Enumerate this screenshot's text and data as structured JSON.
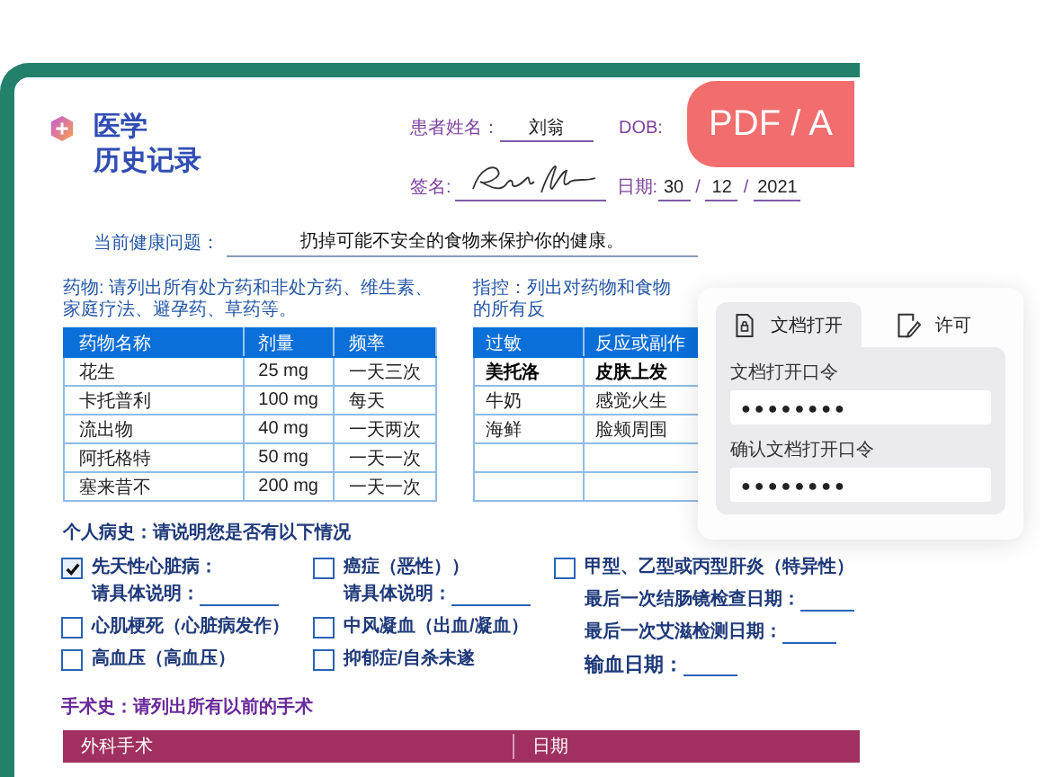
{
  "badge": "PDF / A",
  "document": {
    "title_lines": [
      "医学",
      "历史记录"
    ],
    "patient_name": {
      "label": "患者姓名：",
      "value": "刘翁"
    },
    "dob": {
      "label": "DOB:"
    },
    "signature": {
      "label": "签名:"
    },
    "date": {
      "label": "日期:",
      "separator": "/",
      "day": "30",
      "month": "12",
      "year": "2021"
    },
    "health_issue": {
      "label": "当前健康问题：",
      "value": "扔掉可能不安全的食物来保护你的健康。"
    },
    "medications": {
      "caption": "药物: 请列出所有处方药和非处方药、维生素、家庭疗法、避孕药、草药等。",
      "columns": [
        "药物名称",
        "剂量",
        "频率"
      ],
      "rows": [
        [
          "花生",
          "25 mg",
          "一天三次"
        ],
        [
          "卡托普利",
          "100 mg",
          "每天"
        ],
        [
          "流出物",
          "40 mg",
          "一天两次"
        ],
        [
          "阿托格特",
          "50 mg",
          "一天一次"
        ],
        [
          "塞来昔不",
          "200 mg",
          "一天一次"
        ]
      ]
    },
    "allergies": {
      "caption": "指控：列出对药物和食物的所有反",
      "columns": [
        "过敏",
        "反应或副作"
      ],
      "rows": [
        {
          "cells": [
            "美托洛",
            "皮肤上发"
          ],
          "emphasized": true
        },
        {
          "cells": [
            "牛奶",
            "感觉火生"
          ],
          "emphasized": false
        },
        {
          "cells": [
            "海鲜",
            "脸颊周围"
          ],
          "emphasized": false
        }
      ]
    },
    "history": {
      "title": "个人病史：请说明您是否有以下情况",
      "columns": [
        {
          "items": [
            {
              "kind": "checkbox",
              "label": "先天性心脏病：",
              "checked": true,
              "detail": "请具体说明："
            },
            {
              "kind": "checkbox",
              "label": "心肌梗死（心脏病发作）",
              "checked": false
            },
            {
              "kind": "checkbox",
              "label": "高血压（高血压）",
              "checked": false
            }
          ]
        },
        {
          "items": [
            {
              "kind": "checkbox",
              "label": "癌症（恶性））",
              "checked": false,
              "detail": "请具体说明："
            },
            {
              "kind": "checkbox",
              "label": "中风凝血（出血/凝血）",
              "checked": false
            },
            {
              "kind": "checkbox",
              "label": "抑郁症/自杀未遂",
              "checked": false
            }
          ]
        },
        {
          "items": [
            {
              "kind": "checkbox",
              "label": "甲型、乙型或丙型肝炎（特异性）",
              "checked": false
            },
            {
              "kind": "date_field",
              "label": "最后一次结肠镜检查日期："
            },
            {
              "kind": "date_field",
              "label": "最后一次艾滋检测日期："
            },
            {
              "kind": "major_date_field",
              "label": "输血日期："
            }
          ]
        }
      ]
    },
    "surgery": {
      "title": "手术史：请列出所有以前的手术",
      "columns": [
        "外科手术",
        "日期"
      ]
    }
  },
  "password_panel": {
    "tabs": [
      {
        "label": "文档打开",
        "selected": true,
        "kind": "lock"
      },
      {
        "label": "许可",
        "selected": false,
        "kind": "permission"
      }
    ],
    "fields": [
      {
        "label": "文档打开口令",
        "value": "●●●●●●●●"
      },
      {
        "label": "确认文档打开口令",
        "value": "●●●●●●●●"
      }
    ]
  }
}
